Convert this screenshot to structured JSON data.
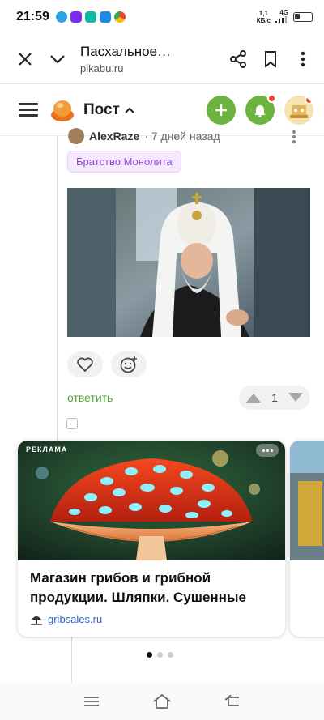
{
  "status": {
    "time": "21:59",
    "net_speed_value": "1,1",
    "net_speed_unit": "КБ/с",
    "network": "4G"
  },
  "browser": {
    "title": "Пасхальное…",
    "url": "pikabu.ru"
  },
  "header": {
    "section": "Пост",
    "accent_color": "#6db33f"
  },
  "comment": {
    "author": "AlexRaze",
    "time": "· 7 дней назад",
    "tag": "Братство Монолита",
    "reply_label": "ответить",
    "rating": "1"
  },
  "ad": {
    "label": "РЕКЛАМА",
    "title": "Магазин грибов и грибной продукции. Шляпки. Сушенные",
    "domain": "gribsales.ru"
  },
  "carousel": {
    "pages": 3,
    "active": 1
  }
}
